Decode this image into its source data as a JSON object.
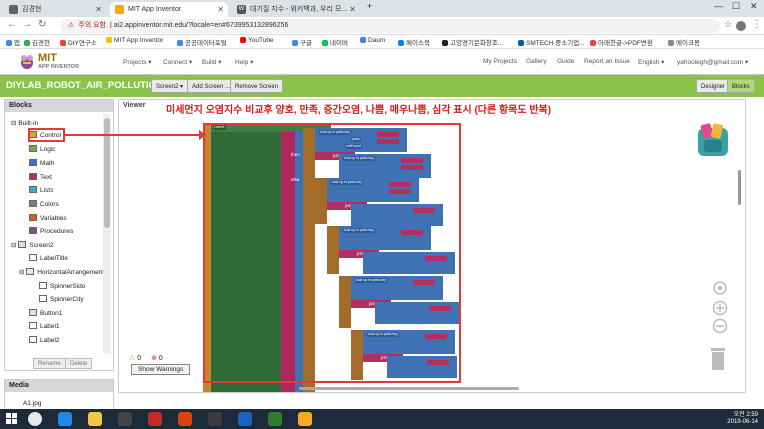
{
  "browser": {
    "tabs": [
      {
        "label": "김경현",
        "color": "#5f6368"
      },
      {
        "label": "MIT App Inventor",
        "color": "#f6a800"
      },
      {
        "label": "대기질 지수 - 위키백과, 우리 모...",
        "color": "#555555"
      }
    ],
    "new_tab": "+",
    "url_warning": "주의 요함",
    "url": "ai2.appinventor.mit.edu/?locale=en#6739953132896256",
    "window_controls": [
      "—",
      "☐",
      "✕"
    ],
    "bookmarks": [
      {
        "label": "앱",
        "color": "#4285f4"
      },
      {
        "label": "김경현",
        "color": "#34a853"
      },
      {
        "label": "DIY연구소",
        "color": "#ea4335"
      },
      {
        "label": "MIT App Inventor",
        "color": "#fbbc05"
      },
      {
        "label": "공공데이터포털",
        "color": "#4285f4"
      },
      {
        "label": "YouTube",
        "color": "#ff0000"
      },
      {
        "label": "구글",
        "color": "#4285f4"
      },
      {
        "label": "네이버",
        "color": "#03c75a"
      },
      {
        "label": "Daum",
        "color": "#4285f4"
      },
      {
        "label": "페이스북",
        "color": "#1877f2"
      },
      {
        "label": "고양경기문화창조...",
        "color": "#222222"
      },
      {
        "label": "SMTECH 중소기업...",
        "color": "#0b5fa5"
      },
      {
        "label": "아래한글->PDF변환",
        "color": "#e04b4b"
      },
      {
        "label": "메이크몽",
        "color": "#888888"
      }
    ]
  },
  "appinventor": {
    "logo_text": "MIT",
    "logo_sub": "APP INVENTOR",
    "menus_left": [
      "Projects ▾",
      "Connect ▾",
      "Build ▾",
      "Help ▾"
    ],
    "menus_right": [
      "My Projects",
      "Gallery",
      "Guide",
      "Report an Issue",
      "English ▾",
      "yahoolegh@gmail.com ▾"
    ],
    "project_name": "DIYLAB_ROBOT_AIR_POLLUTION1",
    "project_buttons": [
      "Screen2 ▾",
      "Add Screen ...",
      "Remove Screen"
    ],
    "mode_buttons": [
      "Designer",
      "Blocks"
    ]
  },
  "blocks_panel": {
    "title": "Blocks",
    "builtin_label": "Built-in",
    "builtin": [
      {
        "label": "Control",
        "color": "#e1a91a"
      },
      {
        "label": "Logic",
        "color": "#77ab41"
      },
      {
        "label": "Math",
        "color": "#3f71b5"
      },
      {
        "label": "Text",
        "color": "#b32d5e"
      },
      {
        "label": "Lists",
        "color": "#49a6d4"
      },
      {
        "label": "Colors",
        "color": "#7d7d7d"
      },
      {
        "label": "Variables",
        "color": "#d05f2d"
      },
      {
        "label": "Procedures",
        "color": "#7c5385"
      }
    ],
    "screen_label": "Screen2",
    "components": [
      "LabelTitle",
      "HorizontalArrangement",
      "SpinnerSido",
      "SpinnerCity",
      "Button1",
      "Label1",
      "Label2"
    ],
    "rename": "Rename",
    "delete": "Delete"
  },
  "media_panel": {
    "title": "Media",
    "files": [
      "A1.jpg"
    ]
  },
  "viewer": {
    "title": "Viewer",
    "annotation": "미세먼지 오염지수 비교후 양호, 만족, 증간오염, 나쁨, 매우나쁨, 심각 표시 (다른 항목도 반복)",
    "warnings_count": "0",
    "errors_count": "0",
    "show_warnings": "Show Warnings"
  },
  "block_chips": {
    "lookup": "look up in pairs key",
    "pairs": "pairs",
    "notfound": "notFound",
    "else": "else",
    "then": "then",
    "join": "join",
    "text_value": "\"... \"",
    "label1": "Label1"
  },
  "taskbar": {
    "time": "오전 2:59",
    "date": "2019-06-14"
  }
}
